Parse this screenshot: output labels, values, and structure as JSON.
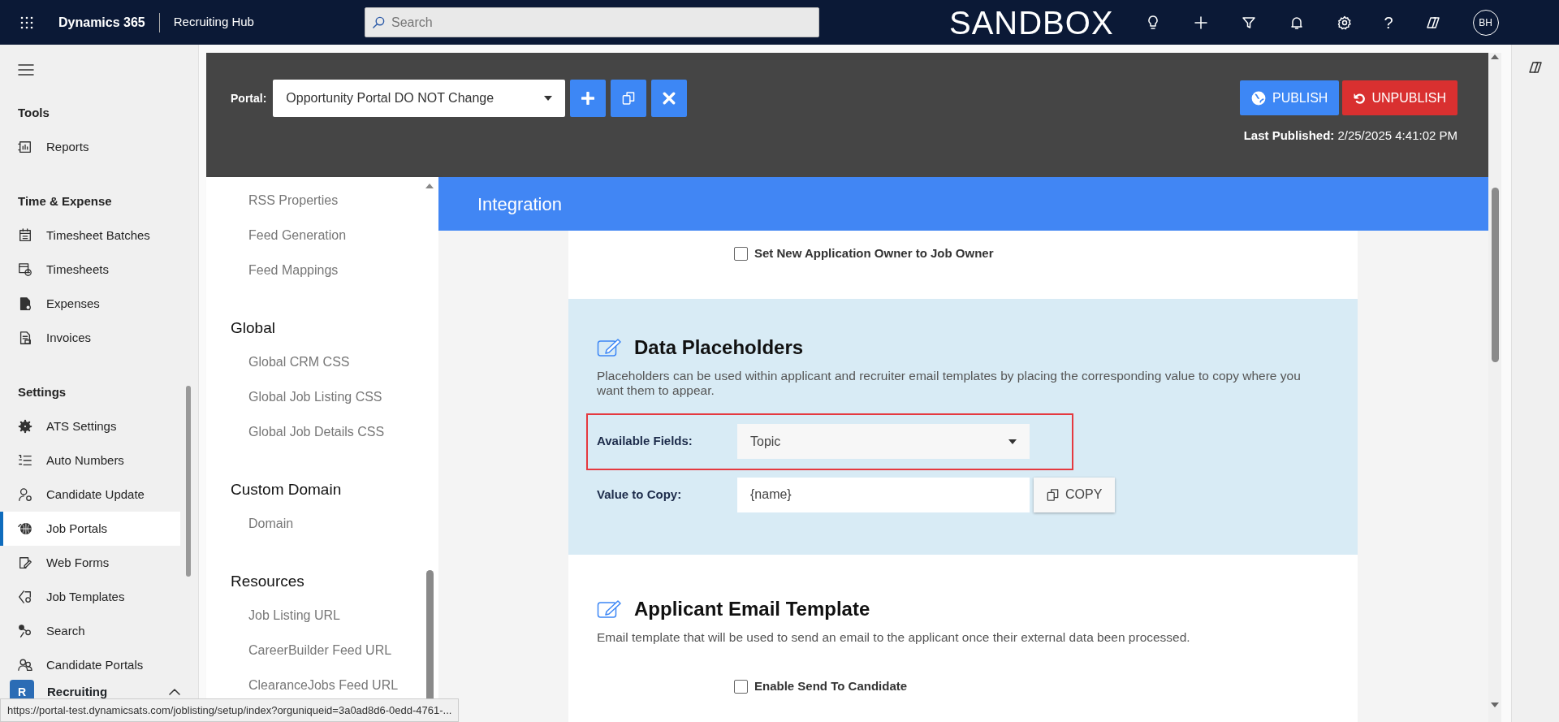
{
  "header": {
    "app_name": "Dynamics 365",
    "area": "Recruiting Hub",
    "search": {
      "placeholder": "Search"
    },
    "environment": "SANDBOX",
    "help": "?",
    "avatar": "BH"
  },
  "sidebar": {
    "sections": [
      {
        "title": "Tools",
        "items": [
          {
            "label": "Reports",
            "selected": false
          }
        ]
      },
      {
        "title": "Time & Expense",
        "items": [
          {
            "label": "Timesheet Batches",
            "selected": false
          },
          {
            "label": "Timesheets",
            "selected": false
          },
          {
            "label": "Expenses",
            "selected": false
          },
          {
            "label": "Invoices",
            "selected": false
          }
        ]
      },
      {
        "title": "Settings",
        "items": [
          {
            "label": "ATS Settings",
            "selected": false
          },
          {
            "label": "Auto Numbers",
            "selected": false
          },
          {
            "label": "Candidate Update",
            "selected": false
          },
          {
            "label": "Job Portals",
            "selected": true
          },
          {
            "label": "Web Forms",
            "selected": false
          },
          {
            "label": "Job Templates",
            "selected": false
          },
          {
            "label": "Search",
            "selected": false
          },
          {
            "label": "Candidate Portals",
            "selected": false
          }
        ]
      }
    ],
    "area_switcher": {
      "badge": "R",
      "label": "Recruiting"
    }
  },
  "portal_bar": {
    "label": "Portal:",
    "portal": "Opportunity Portal DO NOT Change",
    "publish": "PUBLISH",
    "unpublish": "UNPUBLISH",
    "last_published_label": "Last Published:",
    "last_published": "2/25/2025 4:41:02 PM"
  },
  "settings_nav": {
    "groups": [
      {
        "items": [
          "RSS Properties",
          "Feed Generation",
          "Feed Mappings"
        ]
      },
      {
        "title": "Global",
        "items": [
          "Global CRM CSS",
          "Global Job Listing CSS",
          "Global Job Details CSS"
        ]
      },
      {
        "title": "Custom Domain",
        "items": [
          "Domain"
        ]
      },
      {
        "title": "Resources",
        "items": [
          "Job Listing URL",
          "CareerBuilder Feed URL",
          "ClearanceJobs Feed URL"
        ]
      }
    ]
  },
  "page": {
    "title": "Integration",
    "owner_option": {
      "label": "Set New Application Owner to Job Owner",
      "checked": false
    },
    "data_placeholders": {
      "title": "Data Placeholders",
      "description": "Placeholders can be used within applicant and recruiter email templates by placing the corresponding value to copy where you want them to appear.",
      "available_fields_label": "Available Fields:",
      "available_field": "Topic",
      "highlighted": true,
      "value_label": "Value to Copy:",
      "value": "{name}",
      "copy_button": "COPY"
    },
    "applicant_email_template": {
      "title": "Applicant Email Template",
      "description": "Email template that will be used to send an email to the applicant once their external data been processed.",
      "option": {
        "label": "Enable Send To Candidate",
        "checked": false
      }
    }
  },
  "status_url": "https://portal-test.dynamicsats.com/joblisting/setup/index?orguniqueid=3a0ad8d6-0edd-4761-..."
}
